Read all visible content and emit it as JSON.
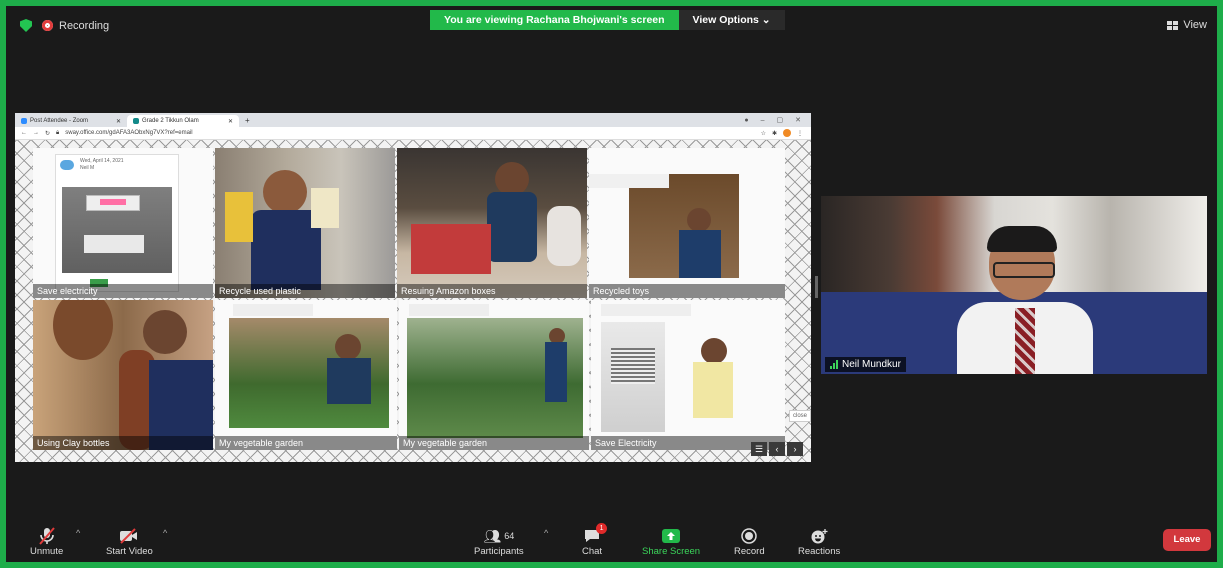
{
  "topbar": {
    "recording_label": "Recording",
    "banner_text": "You are viewing Rachana Bhojwani's screen",
    "view_options_label": "View Options",
    "view_label": "View"
  },
  "browser": {
    "tabs": [
      "Post Attendee - Zoom",
      "Grade 2 Tikkun Olam"
    ],
    "url": "sway.office.com/gdAFA3AObxNg7VX?ref=email",
    "post": {
      "date": "Wed, April 14, 2021",
      "author": "Neil M"
    },
    "tiles": [
      "Save electricity",
      "Recycle used plastic",
      "Resuing Amazon boxes",
      "Recycled toys",
      "Using Clay bottles",
      "My vegetable garden",
      "My vegetable garden",
      "Save Electricity"
    ],
    "close_label": "close"
  },
  "participant": {
    "name": "Neil Mundkur"
  },
  "toolbar": {
    "unmute_label": "Unmute",
    "start_video_label": "Start Video",
    "participants_label": "Participants",
    "participants_count": "64",
    "chat_label": "Chat",
    "chat_badge": "1",
    "share_screen_label": "Share Screen",
    "record_label": "Record",
    "reactions_label": "Reactions",
    "leave_label": "Leave"
  },
  "colors": {
    "frame_border": "#1ead4a",
    "share_green": "#22b94a",
    "leave_red": "#d2383d"
  }
}
